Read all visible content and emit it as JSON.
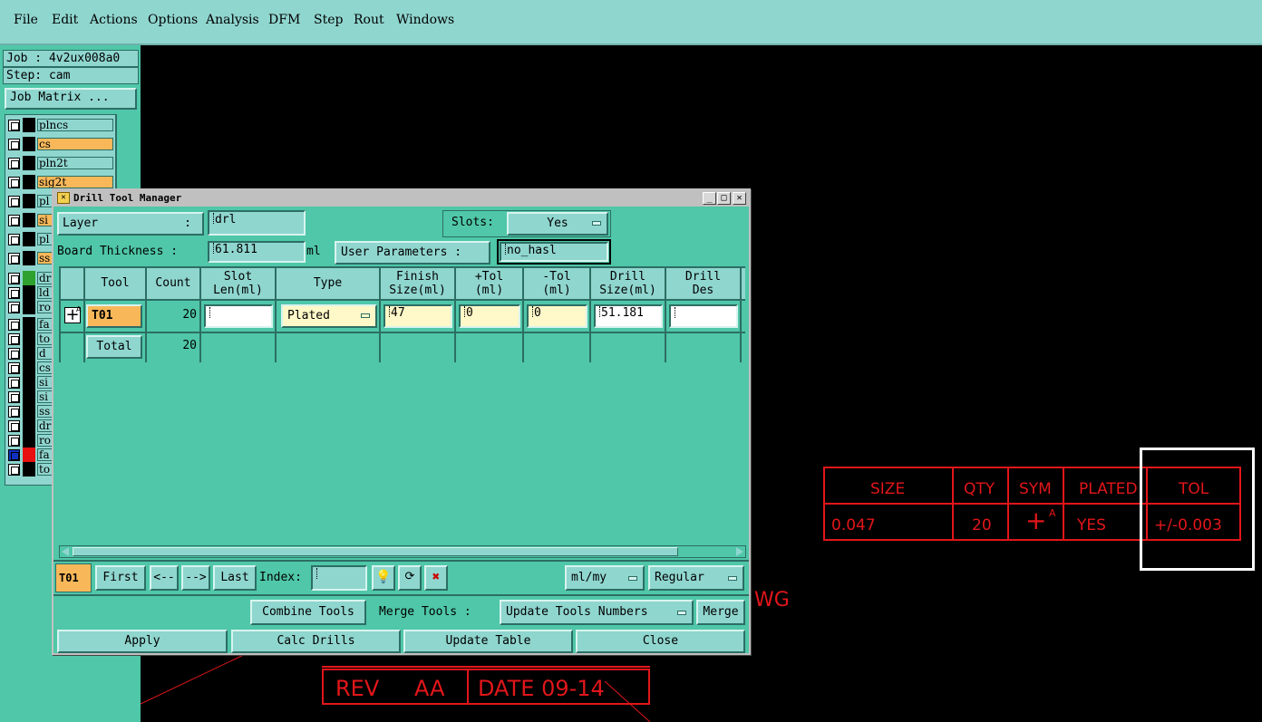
{
  "menu": {
    "items": [
      "File",
      "Edit",
      "Actions",
      "Options",
      "Analysis",
      "DFM",
      "Step",
      "Rout",
      "Windows"
    ]
  },
  "left_panel": {
    "job": "Job : 4v2ux008a0",
    "step": "Step: cam",
    "job_matrix": "Job Matrix ...",
    "layers": [
      {
        "name": "plncs",
        "selected": false,
        "color": "#000000"
      },
      {
        "name": "cs",
        "selected": true,
        "color": "#000000"
      },
      {
        "name": "pln2t",
        "selected": false,
        "color": "#000000"
      },
      {
        "name": "sig2t",
        "selected": true,
        "color": "#000000"
      },
      {
        "name": "pl",
        "selected": false,
        "color": "#000000"
      },
      {
        "name": "si",
        "selected": true,
        "color": "#000000"
      },
      {
        "name": "pl",
        "selected": false,
        "color": "#000000"
      },
      {
        "name": "ss",
        "selected": true,
        "color": "#000000"
      },
      {
        "name": "dr",
        "selected": false,
        "color": "#2ea12e"
      },
      {
        "name": "ld",
        "selected": false,
        "color": "#000000"
      },
      {
        "name": "ro",
        "selected": false,
        "color": "#000000"
      },
      {
        "name": "fa",
        "selected": false,
        "color": "#000000"
      },
      {
        "name": "to",
        "selected": false,
        "color": "#000000"
      },
      {
        "name": "d",
        "selected": false,
        "color": "#000000"
      },
      {
        "name": "cs",
        "selected": false,
        "color": "#000000"
      },
      {
        "name": "si",
        "selected": false,
        "color": "#000000"
      },
      {
        "name": "si",
        "selected": false,
        "color": "#000000"
      },
      {
        "name": "ss",
        "selected": false,
        "color": "#000000"
      },
      {
        "name": "dr",
        "selected": false,
        "color": "#000000"
      },
      {
        "name": "ro",
        "selected": false,
        "color": "#000000"
      },
      {
        "name": "fa",
        "selected": false,
        "color": "#e81010"
      },
      {
        "name": "to",
        "selected": false,
        "color": "#000000"
      }
    ]
  },
  "dialog": {
    "title": "Drill Tool Manager",
    "layer_label": "Layer",
    "layer_colon": ":",
    "layer_value": "drl",
    "slots_label": "Slots:",
    "slots_value": "Yes",
    "board_thickness_label": "Board Thickness :",
    "board_thickness_value": "61.811",
    "board_thickness_unit": "ml",
    "user_params_label": "User Parameters :",
    "user_params_value": "no_hasl",
    "columns": [
      "Tool",
      "Count",
      "Slot\nLen(ml)",
      "Type",
      "Finish\nSize(ml)",
      "+Tol\n(ml)",
      "-Tol\n(ml)",
      "Drill\nSize(ml)",
      "Drill\nDes"
    ],
    "rows": [
      {
        "tool": "T01",
        "count": "20",
        "slot_len": "",
        "type": "Plated",
        "finish": "47",
        "ptol": "0",
        "mtol": "0",
        "drill_size": "51.181",
        "drill_des": ""
      }
    ],
    "total_label": "Total",
    "total_count": "20",
    "nav": {
      "current": "T01",
      "first": "First",
      "prev": "<--",
      "next": "-->",
      "last": "Last",
      "index_label": "Index:",
      "index_value": "",
      "units": "ml/my",
      "mode": "Regular"
    },
    "actions": {
      "combine": "Combine Tools",
      "merge_label": "Merge Tools :",
      "merge_option": "Update Tools Numbers",
      "merge": "Merge",
      "apply": "Apply",
      "calc": "Calc Drills",
      "update": "Update Table",
      "close": "Close"
    }
  },
  "drawing": {
    "table_headers": [
      "SIZE",
      "QTY",
      "SYM",
      "PLATED",
      "TOL"
    ],
    "table_row": [
      "0.047",
      "20",
      "+",
      "YES",
      "+/-0.003"
    ],
    "sym_sup": "A",
    "wg": "WG",
    "rev_label": "REV",
    "rev_value": "AA",
    "date": "DATE 09-14",
    "accent": "#e2161a"
  }
}
